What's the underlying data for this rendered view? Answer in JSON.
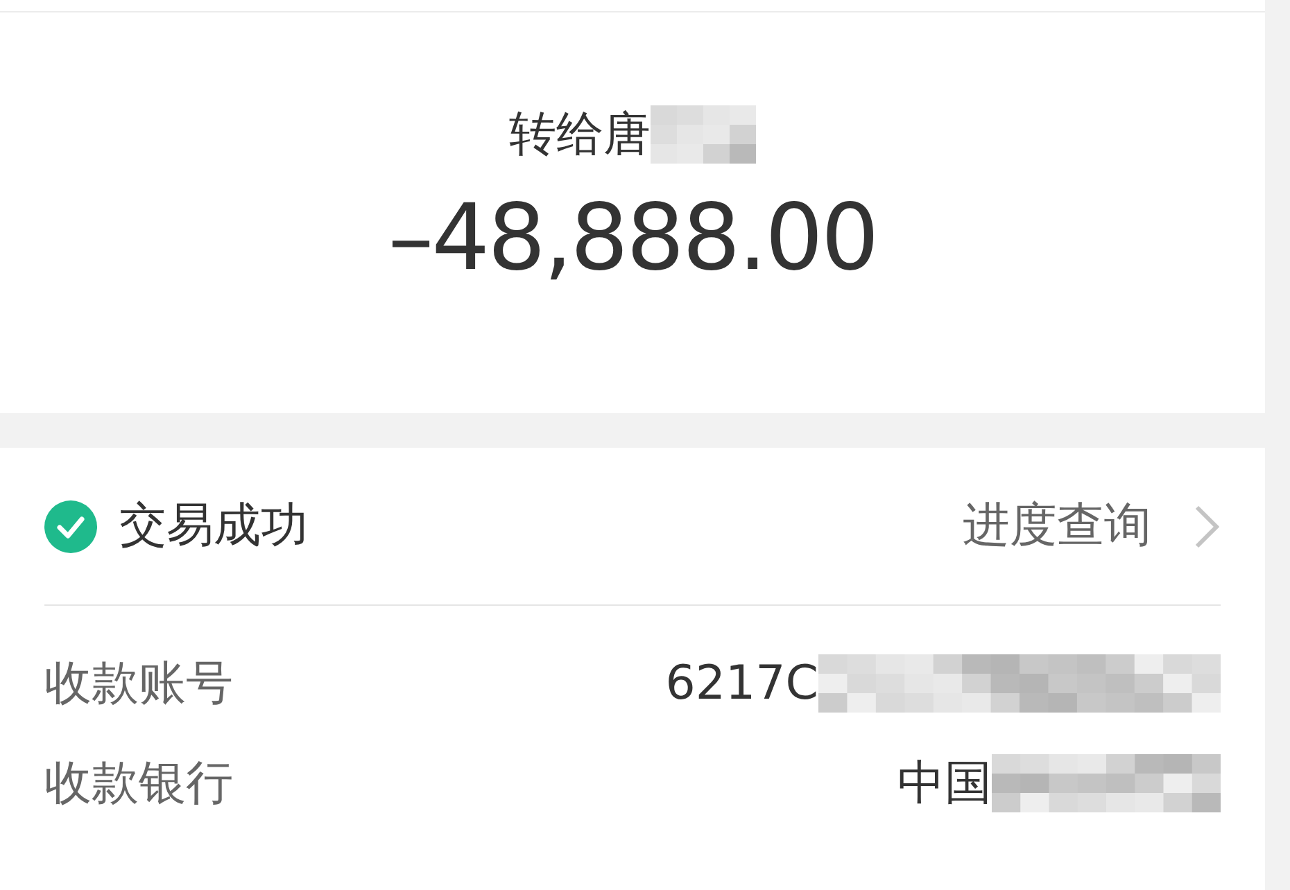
{
  "transfer": {
    "recipient": "转给唐",
    "amount": "–48,888.00"
  },
  "status": {
    "text": "交易成功",
    "success": true,
    "link": "进度查询"
  },
  "details": [
    {
      "label": "收款账号",
      "value": "6217C",
      "redacted": true
    },
    {
      "label": "收款银行",
      "value": "中国",
      "redacted": true
    }
  ]
}
